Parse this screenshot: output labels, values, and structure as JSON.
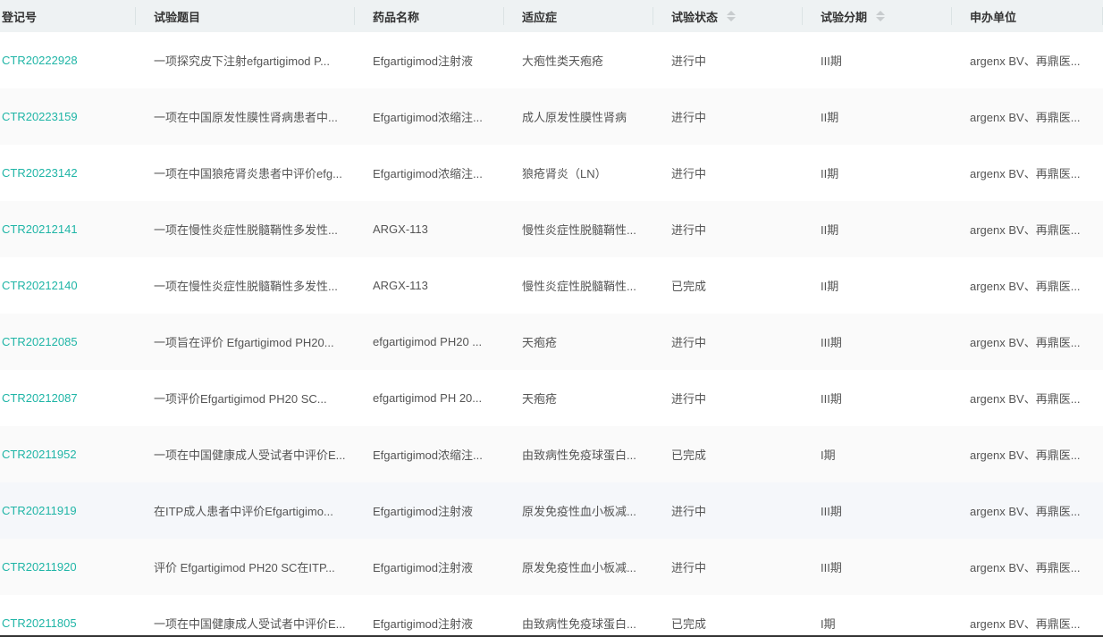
{
  "columns": [
    "登记号",
    "试验题目",
    "药品名称",
    "适应症",
    "试验状态",
    "试验分期",
    "申办单位"
  ],
  "rows": [
    [
      "CTR20222928",
      "一项探究皮下注射efgartigimod P...",
      "Efgartigimod注射液",
      "大疱性类天疱疮",
      "进行中",
      "III期",
      "argenx BV、再鼎医..."
    ],
    [
      "CTR20223159",
      "一项在中国原发性膜性肾病患者中...",
      "Efgartigimod浓缩注...",
      "成人原发性膜性肾病",
      "进行中",
      "II期",
      "argenx BV、再鼎医..."
    ],
    [
      "CTR20223142",
      "一项在中国狼疮肾炎患者中评价efg...",
      "Efgartigimod浓缩注...",
      "狼疮肾炎（LN）",
      "进行中",
      "II期",
      "argenx BV、再鼎医..."
    ],
    [
      "CTR20212141",
      "一项在慢性炎症性脱髓鞘性多发性...",
      "ARGX-113",
      "慢性炎症性脱髓鞘性...",
      "进行中",
      "II期",
      "argenx BV、再鼎医..."
    ],
    [
      "CTR20212140",
      "一项在慢性炎症性脱髓鞘性多发性...",
      "ARGX-113",
      "慢性炎症性脱髓鞘性...",
      "已完成",
      "II期",
      "argenx BV、再鼎医..."
    ],
    [
      "CTR20212085",
      "一项旨在评价 Efgartigimod PH20...",
      "efgartigimod PH20 ...",
      "天疱疮",
      "进行中",
      "III期",
      "argenx BV、再鼎医..."
    ],
    [
      "CTR20212087",
      "一项评价Efgartigimod PH20 SC...",
      "efgartigimod PH 20...",
      "天疱疮",
      "进行中",
      "III期",
      "argenx BV、再鼎医..."
    ],
    [
      "CTR20211952",
      "一项在中国健康成人受试者中评价E...",
      "Efgartigimod浓缩注...",
      "由致病性免疫球蛋白...",
      "已完成",
      "I期",
      "argenx BV、再鼎医..."
    ],
    [
      "CTR20211919",
      "在ITP成人患者中评价Efgartigimo...",
      "Efgartigimod注射液",
      "原发免疫性血小板减...",
      "进行中",
      "III期",
      "argenx BV、再鼎医..."
    ],
    [
      "CTR20211920",
      "评价 Efgartigimod PH20 SC在ITP...",
      "Efgartigimod注射液",
      "原发免疫性血小板减...",
      "进行中",
      "III期",
      "argenx BV、再鼎医..."
    ],
    [
      "CTR20211805",
      "一项在中国健康成人受试者中评价E...",
      "Efgartigimod注射液",
      "由致病性免疫球蛋白...",
      "已完成",
      "I期",
      "argenx BV、再鼎医..."
    ]
  ],
  "colors": {
    "link": "#1fb5a6",
    "header_bg": "#eef2f3"
  }
}
